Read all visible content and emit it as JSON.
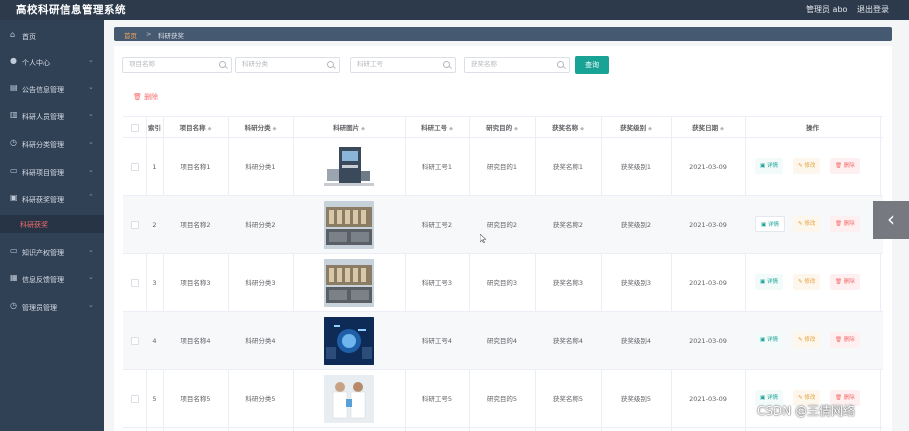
{
  "header": {
    "title": "高校科研信息管理系统",
    "admin": "管理员 abo",
    "logout": "退出登录"
  },
  "sidebar": {
    "items": [
      {
        "label": "首页",
        "icon": "home-icon"
      },
      {
        "label": "个人中心",
        "icon": "user-icon"
      },
      {
        "label": "公告信息管理",
        "icon": "notice-icon"
      },
      {
        "label": "科研人员管理",
        "icon": "book-icon"
      },
      {
        "label": "科研分类管理",
        "icon": "clock-icon"
      },
      {
        "label": "科研项目管理",
        "icon": "chat-icon"
      },
      {
        "label": "科研获奖管理",
        "icon": "trophy-icon"
      },
      {
        "label": "知识产权管理",
        "icon": "chat-icon"
      },
      {
        "label": "信息反馈管理",
        "icon": "feedback-icon"
      },
      {
        "label": "管理员管理",
        "icon": "clock-icon"
      }
    ],
    "sub_active": "科研获奖"
  },
  "breadcrumb": {
    "home": "首页",
    "sep": ">",
    "current": "科研获奖"
  },
  "search": {
    "project_placeholder": "项目名称",
    "category_placeholder": "科研分类",
    "staff_placeholder": "科研工号",
    "award_placeholder": "获奖名称",
    "query_label": "查询"
  },
  "toolbar": {
    "delete_label": "删除"
  },
  "table": {
    "columns": [
      "索引",
      "项目名称",
      "科研分类",
      "科研图片",
      "科研工号",
      "研究目的",
      "获奖名称",
      "获奖级别",
      "获奖日期",
      "操作"
    ],
    "ops": {
      "detail": "详情",
      "edit": "修改",
      "remove": "删除"
    },
    "rows": [
      {
        "index": "1",
        "project": "项目名称1",
        "category": "科研分类1",
        "staff": "科研工号1",
        "purpose": "研究目的1",
        "award": "获奖名称1",
        "level": "获奖级别1",
        "date": "2021-03-09"
      },
      {
        "index": "2",
        "project": "项目名称2",
        "category": "科研分类2",
        "staff": "科研工号2",
        "purpose": "研究目的2",
        "award": "获奖名称2",
        "level": "获奖级别2",
        "date": "2021-03-09"
      },
      {
        "index": "3",
        "project": "项目名称3",
        "category": "科研分类3",
        "staff": "科研工号3",
        "purpose": "研究目的3",
        "award": "获奖名称3",
        "level": "获奖级别3",
        "date": "2021-03-09"
      },
      {
        "index": "4",
        "project": "项目名称4",
        "category": "科研分类4",
        "staff": "科研工号4",
        "purpose": "研究目的4",
        "award": "获奖名称4",
        "level": "获奖级别4",
        "date": "2021-03-09"
      },
      {
        "index": "5",
        "project": "项目名称5",
        "category": "科研分类5",
        "staff": "科研工号5",
        "purpose": "研究目的5",
        "award": "获奖名称5",
        "level": "获奖级别5",
        "date": "2021-03-09"
      }
    ]
  },
  "watermark": "CSDN @王倩网络",
  "colors": {
    "topbar": "#2d3a4b",
    "sidebar": "#304156",
    "accent": "#19a397",
    "danger": "#f56c6c",
    "warning": "#e6a23c",
    "crumb_home": "#f0a35e"
  }
}
